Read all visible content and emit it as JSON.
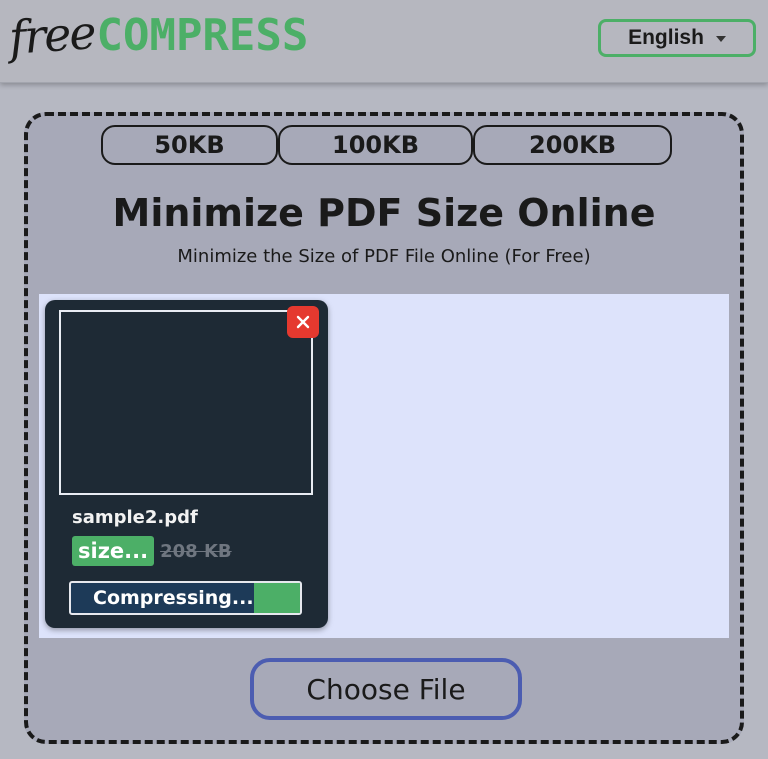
{
  "header": {
    "logo_free": "free",
    "logo_compress": "COMPRESS",
    "language": "English",
    "language_caret_icon": "caret-down-icon"
  },
  "size_tabs": [
    {
      "label": "50KB"
    },
    {
      "label": "100KB"
    },
    {
      "label": "200KB"
    }
  ],
  "main": {
    "title": "Minimize PDF Size Online",
    "subtitle": "Minimize the Size of PDF File Online (For Free)"
  },
  "file": {
    "name": "sample2.pdf",
    "new_size": "size...",
    "original_size": "208 KB",
    "remove_icon": "close-icon",
    "status": "Compressing...",
    "progress_fraction": 0.2
  },
  "choose_file_label": "Choose File",
  "colors": {
    "brand_green": "#4caf67",
    "remove_red": "#e5392f",
    "card_dark": "#1e2a35",
    "dropzone": "#dde3fb",
    "button_border": "#4c5db1"
  }
}
